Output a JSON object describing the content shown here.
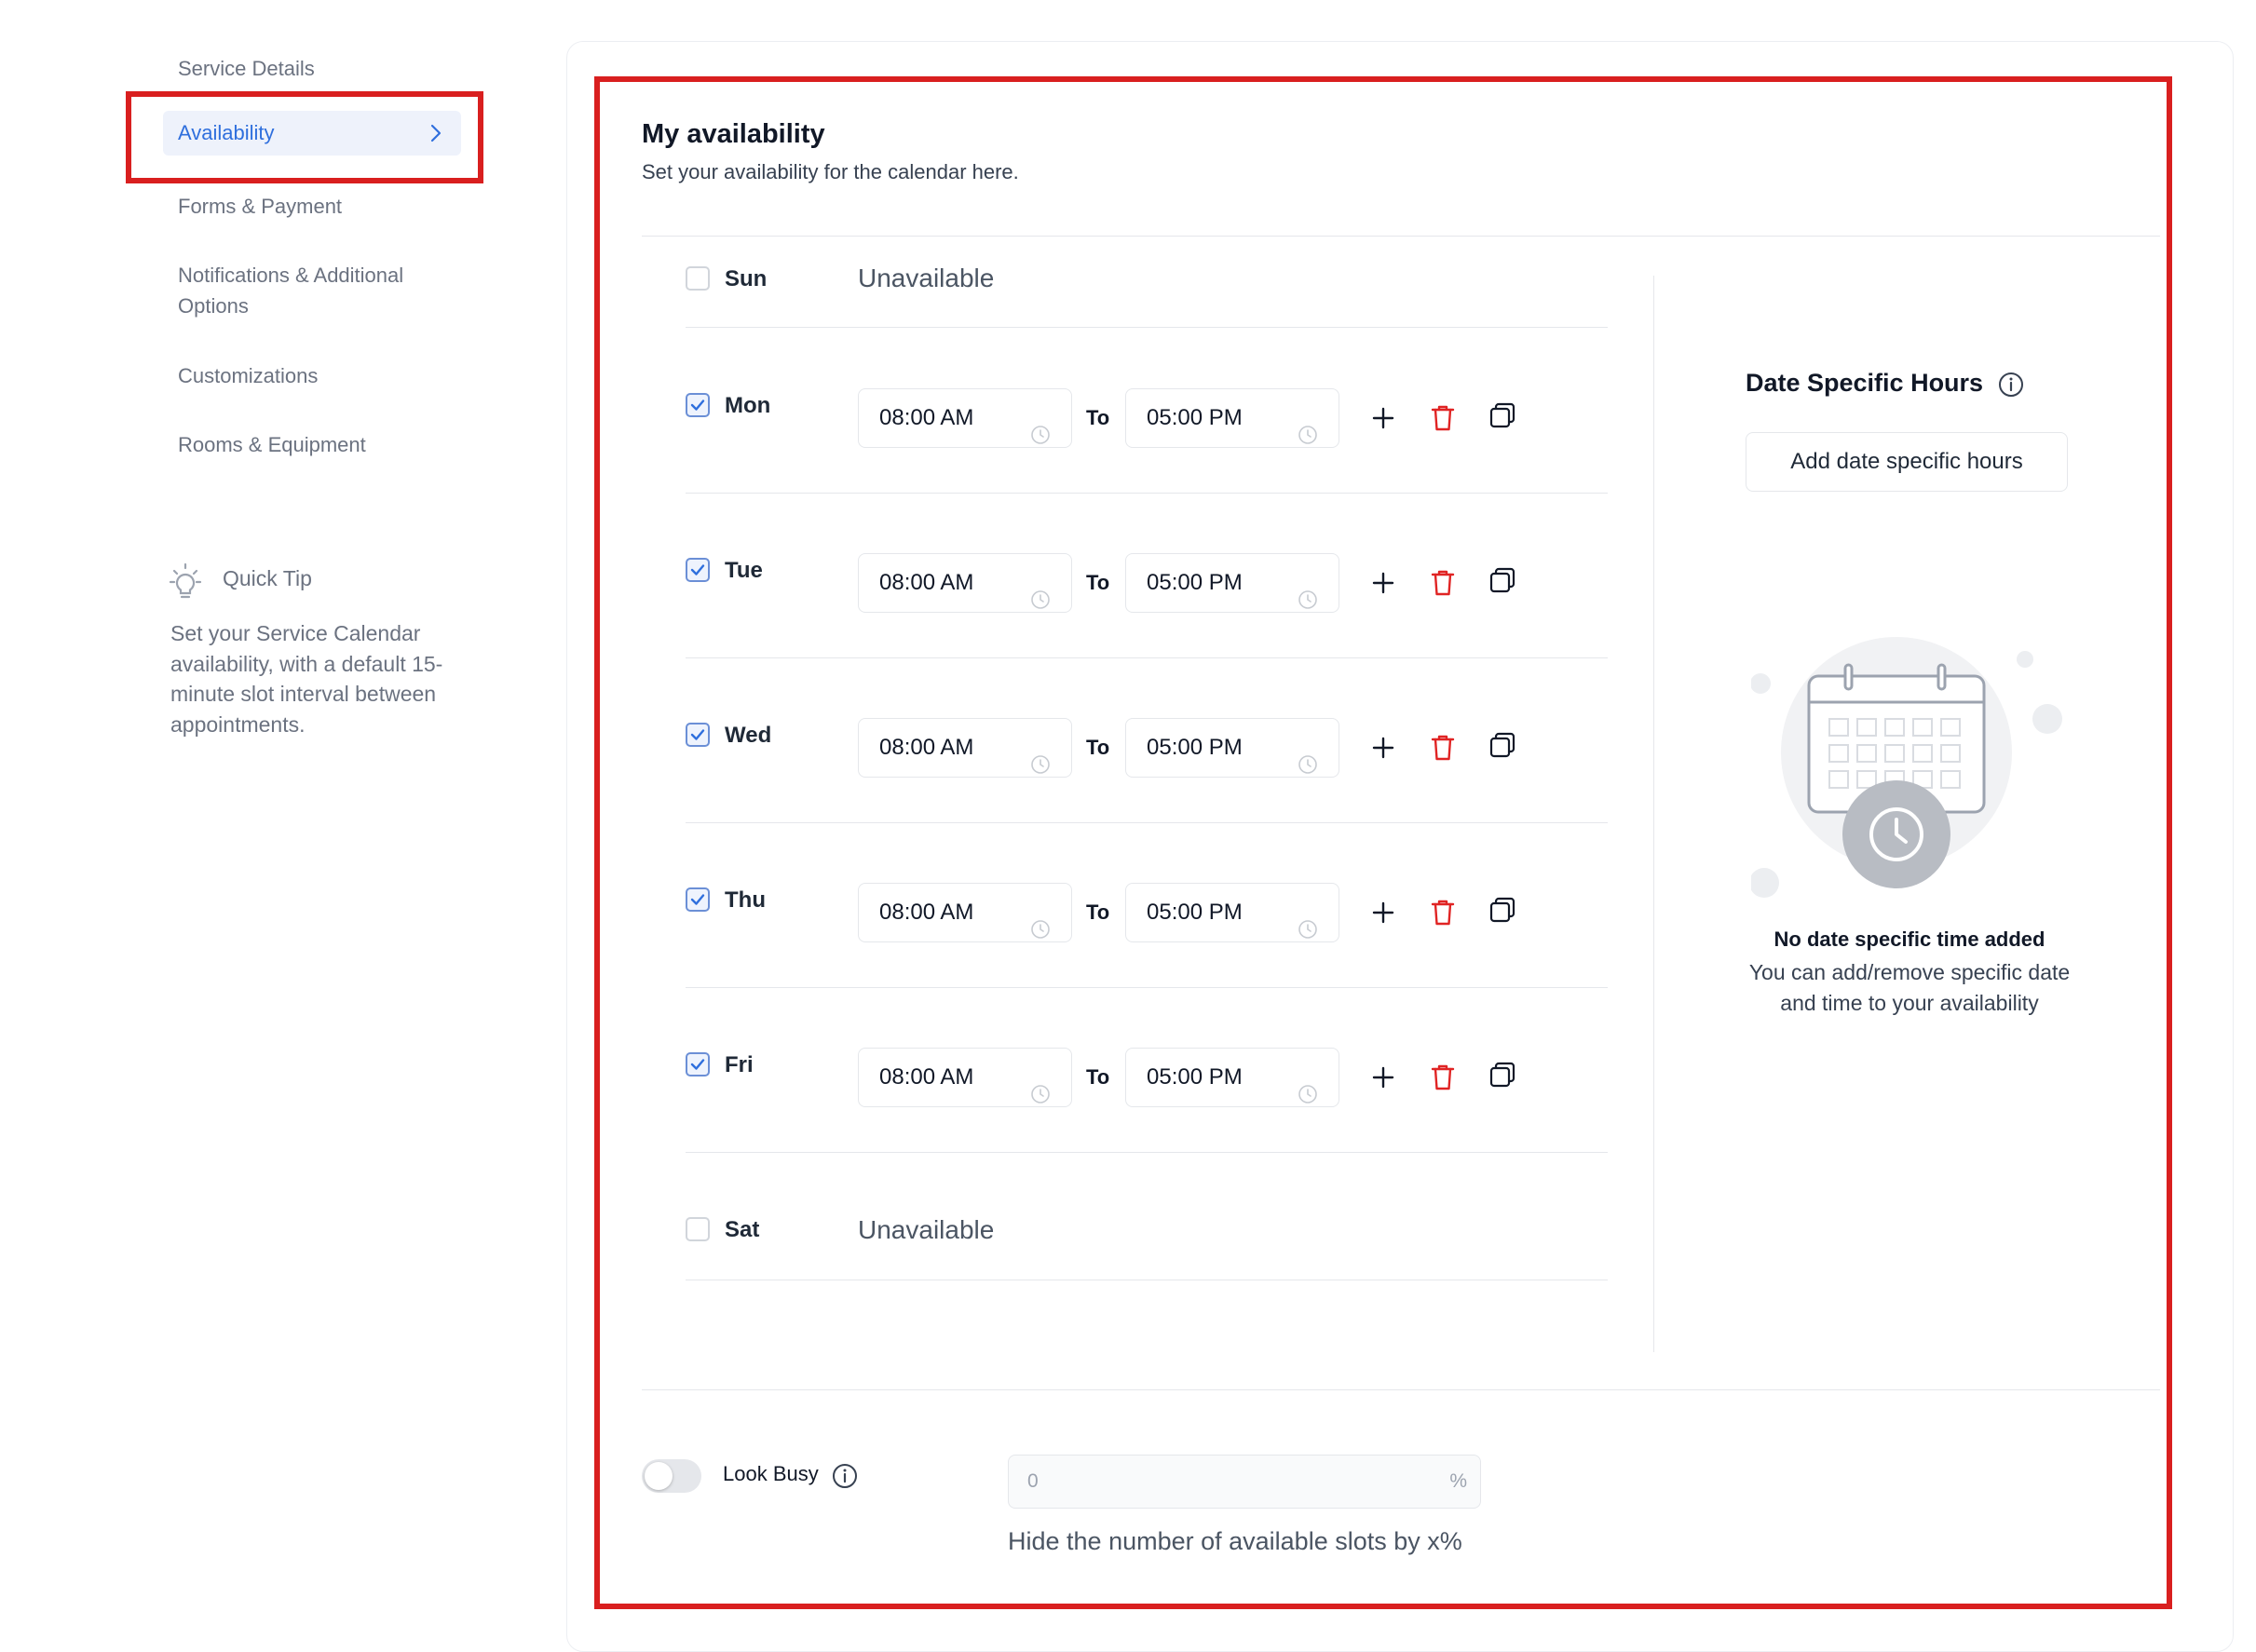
{
  "nav": {
    "items": [
      {
        "label": "Service Details"
      },
      {
        "label": "Availability"
      },
      {
        "label": "Forms & Payment"
      },
      {
        "label": "Notifications & Additional Options"
      },
      {
        "label": "Customizations"
      },
      {
        "label": "Rooms & Equipment"
      }
    ],
    "active_index": 1
  },
  "quick_tip": {
    "title": "Quick Tip",
    "body": "Set your Service Calendar availability, with a default 15-minute slot interval between appointments."
  },
  "availability": {
    "title": "My availability",
    "subtitle": "Set your availability for the calendar here.",
    "to_label": "To",
    "unavailable_label": "Unavailable",
    "days": [
      {
        "day": "Sun",
        "enabled": false
      },
      {
        "day": "Mon",
        "enabled": true,
        "start": "08:00 AM",
        "end": "05:00 PM"
      },
      {
        "day": "Tue",
        "enabled": true,
        "start": "08:00 AM",
        "end": "05:00 PM"
      },
      {
        "day": "Wed",
        "enabled": true,
        "start": "08:00 AM",
        "end": "05:00 PM"
      },
      {
        "day": "Thu",
        "enabled": true,
        "start": "08:00 AM",
        "end": "05:00 PM"
      },
      {
        "day": "Fri",
        "enabled": true,
        "start": "08:00 AM",
        "end": "05:00 PM"
      },
      {
        "day": "Sat",
        "enabled": false
      }
    ]
  },
  "date_specific": {
    "title": "Date Specific Hours",
    "button_label": "Add date specific hours",
    "empty_title": "No date specific time added",
    "empty_body": "You can add/remove specific date and time to your availability"
  },
  "look_busy": {
    "label": "Look Busy",
    "enabled": false,
    "value_placeholder": "0",
    "suffix": "%",
    "help": "Hide the number of available slots by x%"
  },
  "colors": {
    "accent": "#2f6fdd",
    "highlight": "#d91f1f",
    "delete": "#e02424"
  },
  "icons": {
    "nav_active": "chevron-right-icon",
    "tip": "lightbulb-icon",
    "info": "info-icon",
    "add": "plus-icon",
    "delete": "trash-icon",
    "copy": "copy-icon",
    "clock": "clock-icon",
    "empty": "calendar-clock-illustration"
  }
}
